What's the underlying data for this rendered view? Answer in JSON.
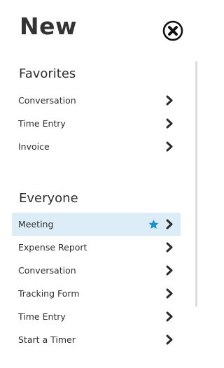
{
  "panel": {
    "title": "New",
    "close_icon": "close-circle-icon"
  },
  "favorites": {
    "heading": "Favorites",
    "items": [
      {
        "label": "Conversation"
      },
      {
        "label": "Time Entry"
      },
      {
        "label": "Invoice"
      }
    ]
  },
  "everyone": {
    "heading": "Everyone",
    "items": [
      {
        "label": "Meeting",
        "highlighted": true,
        "starred": true
      },
      {
        "label": "Expense Report"
      },
      {
        "label": "Conversation"
      },
      {
        "label": "Tracking Form"
      },
      {
        "label": "Time Entry"
      },
      {
        "label": "Start a Timer"
      }
    ]
  },
  "colors": {
    "highlight_bg": "#dcedf7",
    "star": "#1e8fc9",
    "chevron": "#2b2b2b"
  }
}
